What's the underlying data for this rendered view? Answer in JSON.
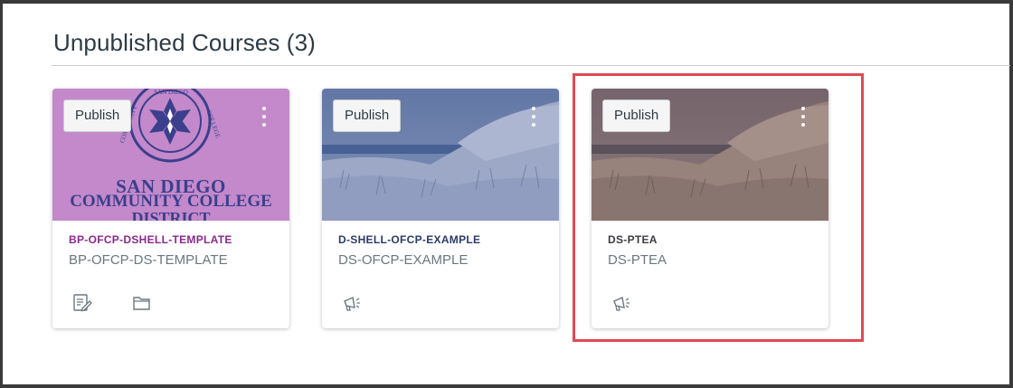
{
  "section": {
    "title": "Unpublished Courses (3)"
  },
  "colors": {
    "accent_purple": "#8a2a8e",
    "accent_navy": "#2d3b6b",
    "text_dark": "#2d3b45",
    "text_muted": "#6b7780",
    "highlight": "#e04a53"
  },
  "cards": [
    {
      "publish_label": "Publish",
      "title": "BP-OFCP-DSHELL-TEMPLATE",
      "subtitle": "BP-OFCP-DS-TEMPLATE",
      "hero_text_line1": "SAN DIEGO",
      "hero_text_line2": "COMMUNITY COLLEGE",
      "hero_text_line3": "DISTRICT",
      "seal_text": "SAN DIEGO COMMUNITY COLLEGE DISTRICT",
      "icons": [
        "assignments-icon",
        "files-icon"
      ]
    },
    {
      "publish_label": "Publish",
      "title": "D-SHELL-OFCP-EXAMPLE",
      "subtitle": "DS-OFCP-EXAMPLE",
      "icons": [
        "announcements-icon"
      ]
    },
    {
      "publish_label": "Publish",
      "title": "DS-PTEA",
      "subtitle": "DS-PTEA",
      "icons": [
        "announcements-icon"
      ]
    }
  ]
}
